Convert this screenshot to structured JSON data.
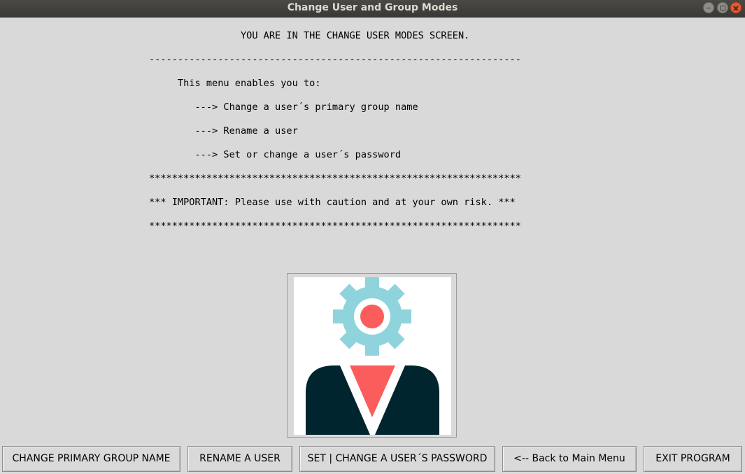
{
  "window": {
    "title": "Change User and Group Modes"
  },
  "message": {
    "lines": [
      "                YOU ARE IN THE CHANGE USER MODES SCREEN.",
      "-----------------------------------------------------------------",
      "     This menu enables you to:",
      "        ---> Change a user´s primary group name",
      "        ---> Rename a user",
      "        ---> Set or change a user´s password",
      "*****************************************************************",
      "*** IMPORTANT: Please use with caution and at your own risk. ***",
      "*****************************************************************"
    ]
  },
  "illustration": {
    "icon": "user-gear-icon",
    "colors": {
      "gear": "#8fd3dd",
      "accent": "#fb5d5d",
      "suit": "#00252f",
      "background": "#ffffff"
    }
  },
  "buttons": {
    "change_primary_group": "CHANGE PRIMARY GROUP NAME",
    "rename_user": "RENAME A USER",
    "set_password": "SET | CHANGE A USER´S PASSWORD",
    "back": "<-- Back to Main Menu",
    "exit": "EXIT PROGRAM"
  }
}
